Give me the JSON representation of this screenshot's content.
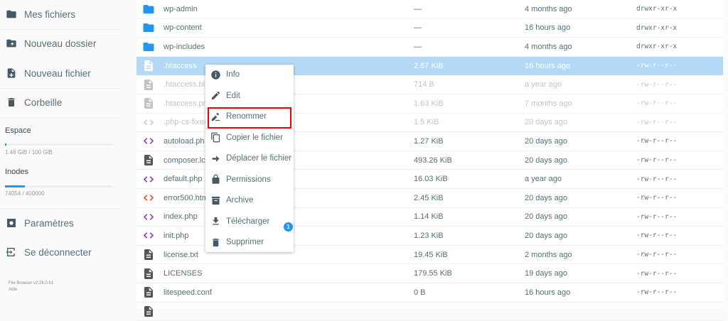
{
  "sidebar": {
    "my_files": "Mes fichiers",
    "new_folder": "Nouveau dossier",
    "new_file": "Nouveau fichier",
    "trash": "Corbeille",
    "space_label": "Espace",
    "space_text": "1.48 GiB / 100 GiB",
    "space_pct": 1.48,
    "inodes_label": "Inodes",
    "inodes_text": "74054 / 400000",
    "inodes_pct": 18.5,
    "settings": "Paramètres",
    "logout": "Se déconnecter",
    "version": "File Browser v2.26.0-h1",
    "help": "Aide"
  },
  "files": [
    {
      "name": "wp-admin",
      "size": "—",
      "modified": "4 months ago",
      "perms": "drwxr-xr-x",
      "type": "folder"
    },
    {
      "name": "wp-content",
      "size": "—",
      "modified": "16 hours ago",
      "perms": "drwxr-xr-x",
      "type": "folder"
    },
    {
      "name": "wp-includes",
      "size": "—",
      "modified": "4 months ago",
      "perms": "drwxr-xr-x",
      "type": "folder"
    },
    {
      "name": ".htaccess",
      "size": "2.67 KiB",
      "modified": "16 hours ago",
      "perms": "-rw-r--r--",
      "type": "doc",
      "state": "sel"
    },
    {
      "name": ".htaccess.bl",
      "size": "714 B",
      "modified": "a year ago",
      "perms": "-rw-r--r--",
      "type": "doc",
      "state": "dim"
    },
    {
      "name": ".htaccess.pr",
      "size": "1.63 KiB",
      "modified": "7 months ago",
      "perms": "-rw-r--r--",
      "type": "doc",
      "state": "dim"
    },
    {
      "name": ".php-cs-fixer",
      "size": "1.5 KiB",
      "modified": "20 days ago",
      "perms": "-rw-r--r--",
      "type": "code",
      "state": "dim"
    },
    {
      "name": "autoload.ph",
      "size": "1.27 KiB",
      "modified": "20 days ago",
      "perms": "-rw-r--r--",
      "type": "code"
    },
    {
      "name": "composer.lc",
      "size": "493.26 KiB",
      "modified": "20 days ago",
      "perms": "-rw-r--r--",
      "type": "docdark"
    },
    {
      "name": "default.php",
      "size": "16.03 KiB",
      "modified": "a year ago",
      "perms": "-rw-r--r--",
      "type": "code"
    },
    {
      "name": "error500.htm",
      "size": "2.45 KiB",
      "modified": "20 days ago",
      "perms": "-rw-r--r--",
      "type": "html"
    },
    {
      "name": "index.php",
      "size": "1.14 KiB",
      "modified": "20 days ago",
      "perms": "-rw-r--r--",
      "type": "code"
    },
    {
      "name": "init.php",
      "size": "1.23 KiB",
      "modified": "20 days ago",
      "perms": "-rw-r--r--",
      "type": "code"
    },
    {
      "name": "license.txt",
      "size": "19.45 KiB",
      "modified": "2 months ago",
      "perms": "-rw-r--r--",
      "type": "docdark"
    },
    {
      "name": "LICENSES",
      "size": "179.55 KiB",
      "modified": "19 days ago",
      "perms": "-rw-r--r--",
      "type": "docdark"
    },
    {
      "name": "litespeed.conf",
      "size": "0 B",
      "modified": "16 hours ago",
      "perms": "-rw-r--r--",
      "type": "docdark"
    },
    {
      "name": "",
      "size": "",
      "modified": "",
      "perms": "",
      "type": "docdark"
    }
  ],
  "menu": [
    {
      "label": "Info",
      "icon": "info-icon"
    },
    {
      "label": "Edit",
      "icon": "pencil-icon"
    },
    {
      "label": "Renommer",
      "icon": "rename-icon"
    },
    {
      "label": "Copier le fichier",
      "icon": "copy-icon"
    },
    {
      "label": "Déplacer le fichier",
      "icon": "move-icon"
    },
    {
      "label": "Permissions",
      "icon": "lock-icon"
    },
    {
      "label": "Archive",
      "icon": "archive-icon"
    },
    {
      "label": "Télécharger",
      "icon": "download-icon"
    },
    {
      "label": "Supprimer",
      "icon": "trash-icon"
    }
  ],
  "badge": "1",
  "colors": {
    "accent": "#2196f3",
    "selected": "#b3d9f7",
    "highlight": "#ee0000"
  }
}
